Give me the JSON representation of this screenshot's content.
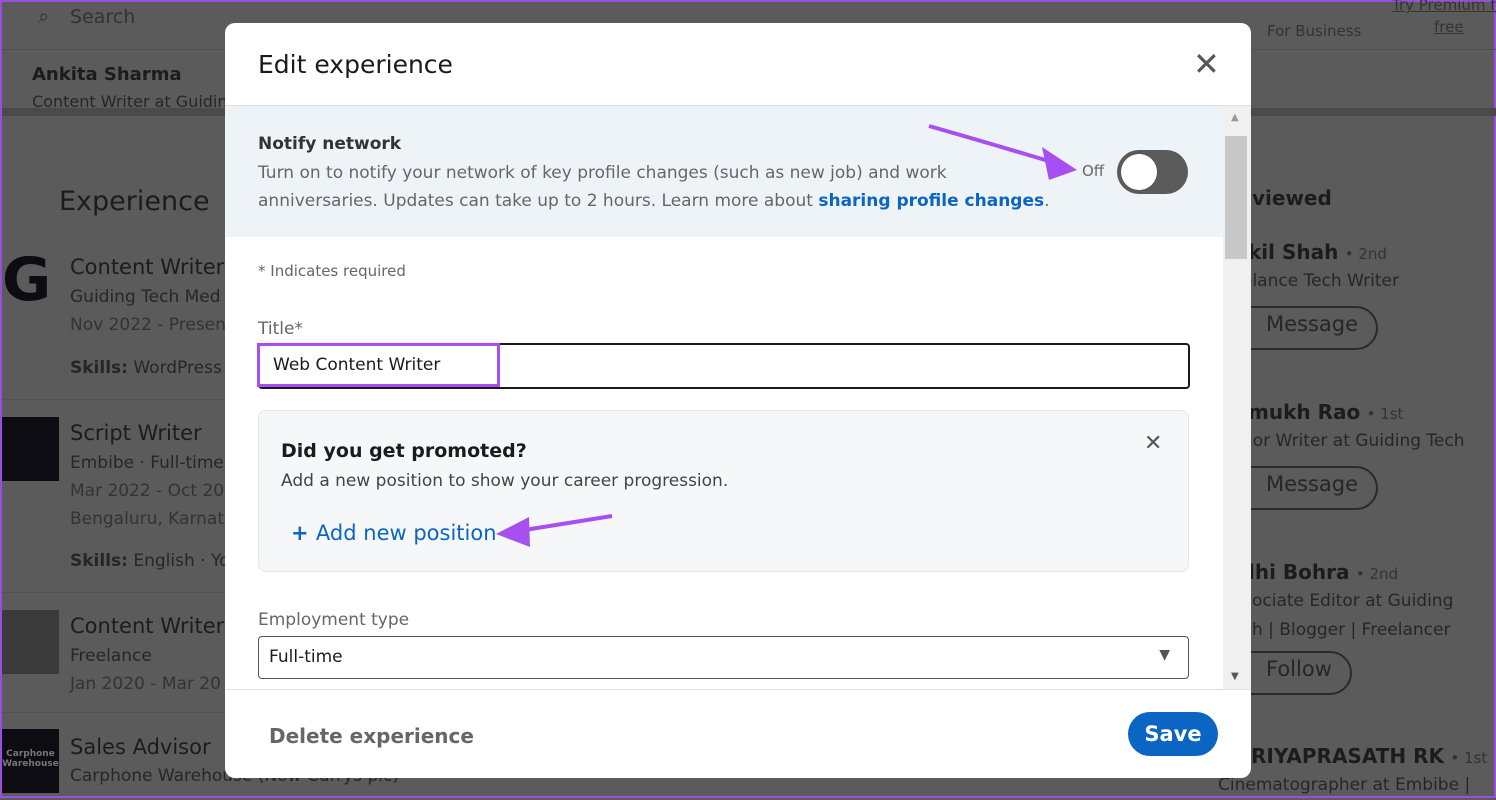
{
  "nav": {
    "search_placeholder": "Search",
    "for_business": "For Business",
    "premium_line1": "Try Premium fo",
    "premium_line2": "free"
  },
  "profile": {
    "name": "Ankita Sharma",
    "headline": "Content Writer at Guiding"
  },
  "experience": {
    "heading": "Experience",
    "items": [
      {
        "title": "Content Writer",
        "company": "Guiding Tech Med",
        "dates": "Nov 2022 - Presen",
        "skills_label": "Skills:",
        "skills": "WordPress"
      },
      {
        "title": "Script Writer",
        "company": "Embibe · Full-time",
        "dates": "Mar 2022 - Oct 20",
        "location": "Bengaluru, Karnata",
        "skills_label": "Skills:",
        "skills": "English · You"
      },
      {
        "title": "Content Writer",
        "company": "Freelance",
        "dates": "Jan 2020 - Mar 20"
      },
      {
        "title": "Sales Advisor",
        "company": "Carphone Warehouse (Now Currys plc)",
        "logo_text": "Carphone Warehouse"
      }
    ]
  },
  "sidebar": {
    "heading": "viewed",
    "people": [
      {
        "name": "kil Shah",
        "degree": "• 2nd",
        "headline": "elance Tech Writer",
        "action": "Message"
      },
      {
        "name": "mukh Rao",
        "degree": "• 1st",
        "headline": "ior Writer at Guiding Tech",
        "action": "Message"
      },
      {
        "name": "lhi Bohra",
        "degree": "• 2nd",
        "headline": "ociate Editor at Guiding",
        "headline2": "h | Blogger | Freelancer",
        "action": "Follow"
      },
      {
        "name": "RIYAPRASATH RK",
        "degree": "• 1st",
        "headline": "Cinematographer at Embibe |"
      }
    ]
  },
  "modal": {
    "title": "Edit experience",
    "notify": {
      "heading": "Notify network",
      "text1": "Turn on to notify your network of key profile changes (such as new job) and work",
      "text2": "anniversaries. Updates can take up to 2 hours. Learn more about ",
      "link": "sharing profile changes",
      "period": ".",
      "toggle_state": "Off",
      "enabled": false
    },
    "required_note": "* Indicates required",
    "title_label": "Title*",
    "title_value": "Web Content Writer",
    "promo": {
      "heading": "Did you get promoted?",
      "text": "Add a new position to show your career progression.",
      "action": "Add new position"
    },
    "employment_label": "Employment type",
    "employment_value": "Full-time",
    "delete": "Delete experience",
    "save": "Save"
  },
  "colors": {
    "accent": "#0a66c2",
    "annotation": "#a74ff0"
  }
}
